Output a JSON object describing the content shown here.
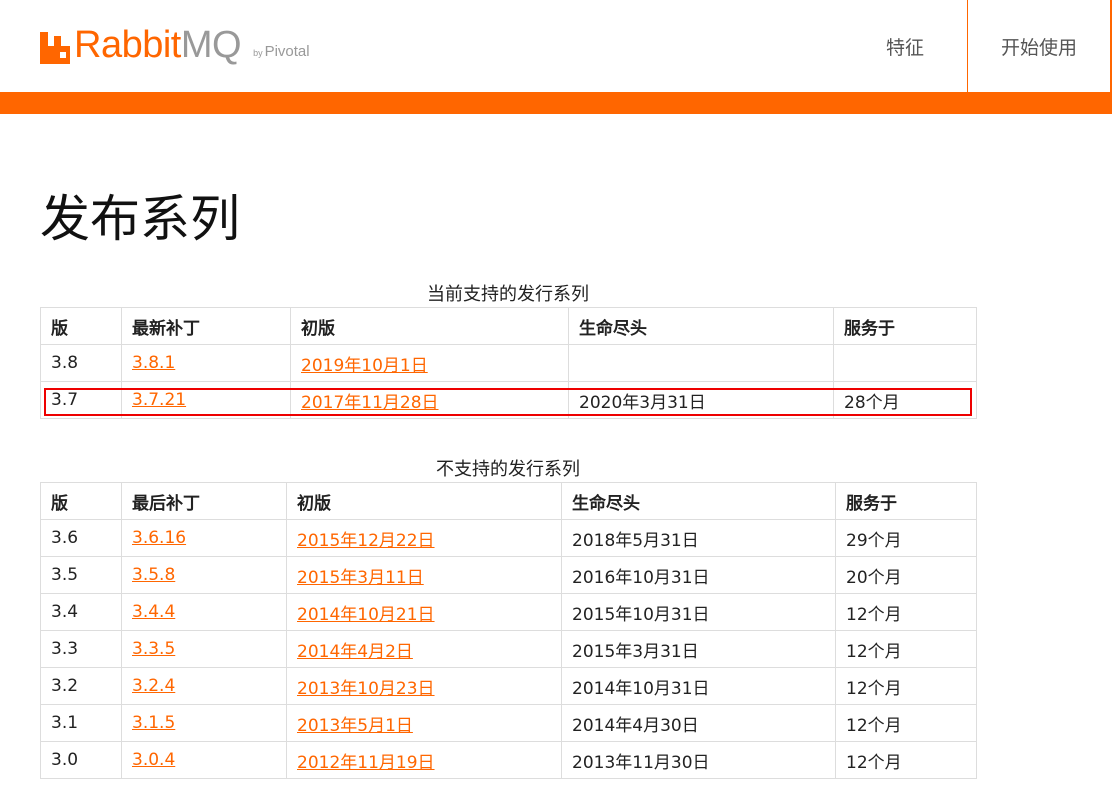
{
  "header": {
    "logo_text_rabbit": "Rabbit",
    "logo_text_mq": "MQ",
    "logo_by": "by",
    "logo_pivotal": "Pivotal",
    "nav": [
      {
        "label": "特征"
      },
      {
        "label": "开始使用"
      }
    ],
    "accent_color": "#ff6600"
  },
  "page": {
    "title": "发布系列"
  },
  "supported": {
    "caption": "当前支持的发行系列",
    "headers": [
      "版",
      "最新补丁",
      "初版",
      "生命尽头",
      "服务于"
    ],
    "rows": [
      {
        "version": "3.8",
        "patch": "3.8.1",
        "initial": "2019年10月1日",
        "eol": "",
        "served": ""
      },
      {
        "version": "3.7",
        "patch": "3.7.21",
        "initial": "2017年11月28日",
        "eol": "2020年3月31日",
        "served": "28个月"
      }
    ]
  },
  "unsupported": {
    "caption": "不支持的发行系列",
    "headers": [
      "版",
      "最后补丁",
      "初版",
      "生命尽头",
      "服务于"
    ],
    "rows": [
      {
        "version": "3.6",
        "patch": "3.6.16",
        "initial": "2015年12月22日",
        "eol": "2018年5月31日",
        "served": "29个月"
      },
      {
        "version": "3.5",
        "patch": "3.5.8",
        "initial": "2015年3月11日",
        "eol": "2016年10月31日",
        "served": "20个月"
      },
      {
        "version": "3.4",
        "patch": "3.4.4",
        "initial": "2014年10月21日",
        "eol": "2015年10月31日",
        "served": "12个月"
      },
      {
        "version": "3.3",
        "patch": "3.3.5",
        "initial": "2014年4月2日",
        "eol": "2015年3月31日",
        "served": "12个月"
      },
      {
        "version": "3.2",
        "patch": "3.2.4",
        "initial": "2013年10月23日",
        "eol": "2014年10月31日",
        "served": "12个月"
      },
      {
        "version": "3.1",
        "patch": "3.1.5",
        "initial": "2013年5月1日",
        "eol": "2014年4月30日",
        "served": "12个月"
      },
      {
        "version": "3.0",
        "patch": "3.0.4",
        "initial": "2012年11月19日",
        "eol": "2013年11月30日",
        "served": "12个月"
      }
    ]
  }
}
